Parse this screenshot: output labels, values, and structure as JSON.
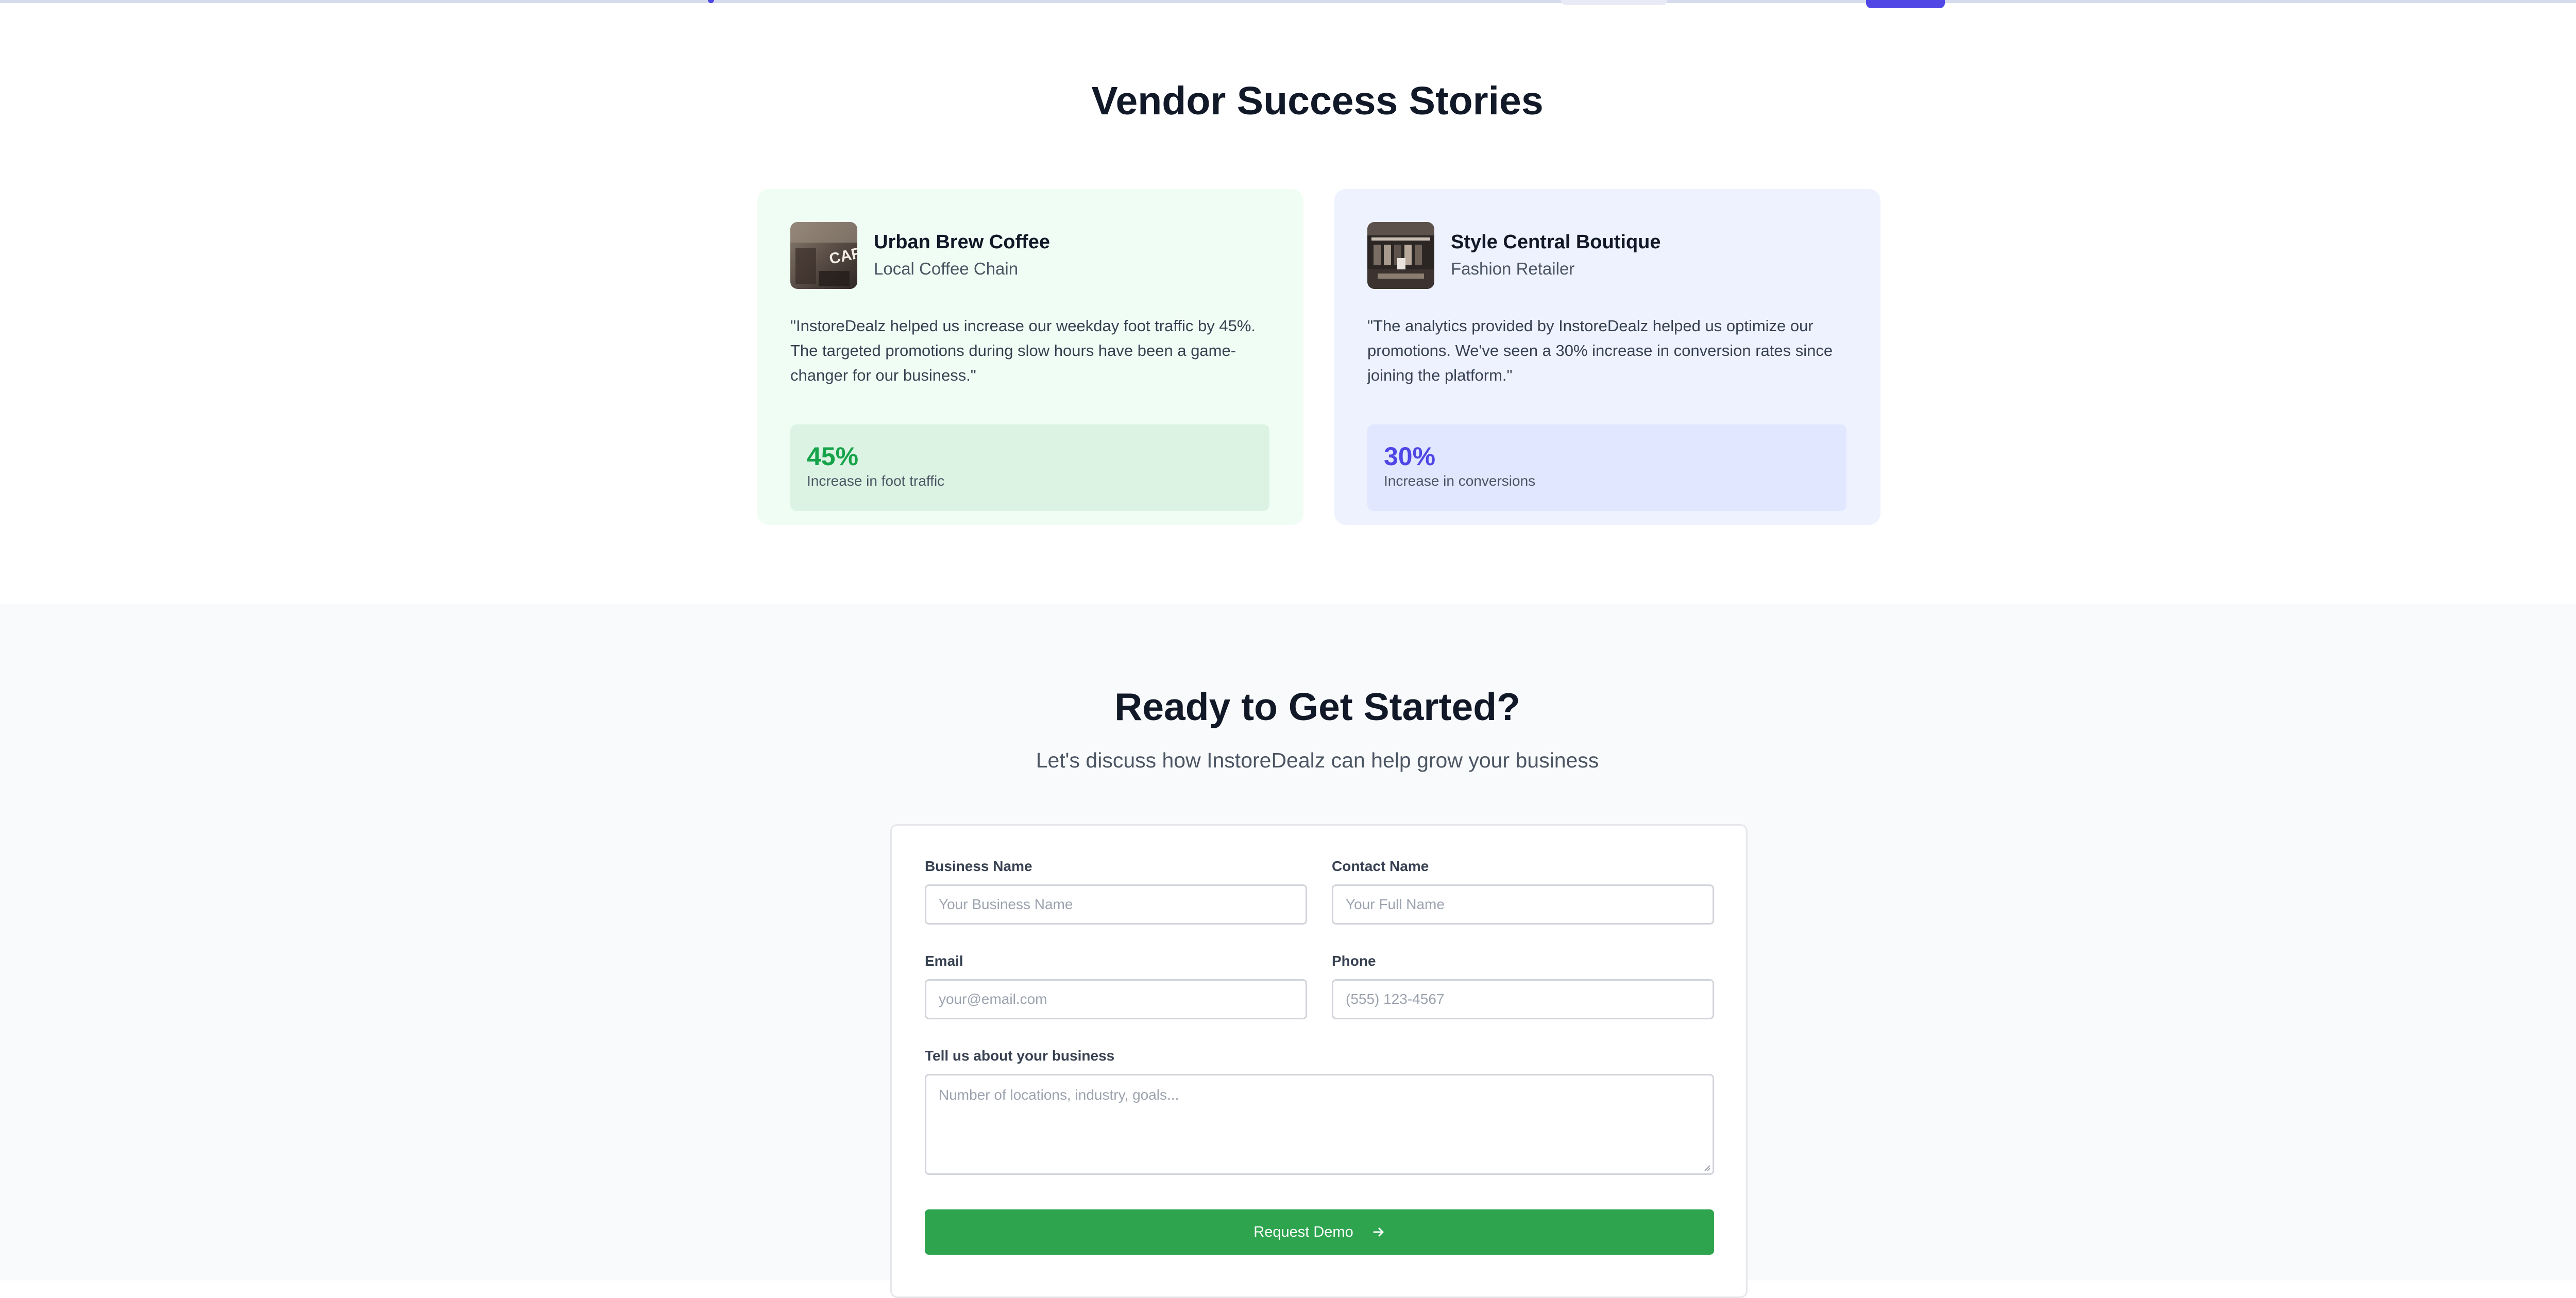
{
  "stories": {
    "title": "Vendor Success Stories",
    "cards": [
      {
        "name": "Urban Brew Coffee",
        "type": "Local Coffee Chain",
        "quote": "\"InstoreDealz helped us increase our weekday foot traffic by 45%. The targeted promotions during slow hours have been a game-changer for our business.\"",
        "stat_value": "45%",
        "stat_label": "Increase in foot traffic",
        "accent": "#16a34a"
      },
      {
        "name": "Style Central Boutique",
        "type": "Fashion Retailer",
        "quote": "\"The analytics provided by InstoreDealz helped us optimize our promotions. We've seen a 30% increase in conversion rates since joining the platform.\"",
        "stat_value": "30%",
        "stat_label": "Increase in conversions",
        "accent": "#4f46e5"
      }
    ]
  },
  "cta": {
    "title": "Ready to Get Started?",
    "subtitle": "Let's discuss how InstoreDealz can help grow your business",
    "form": {
      "business_name": {
        "label": "Business Name",
        "placeholder": "Your Business Name"
      },
      "contact_name": {
        "label": "Contact Name",
        "placeholder": "Your Full Name"
      },
      "email": {
        "label": "Email",
        "placeholder": "your@email.com"
      },
      "phone": {
        "label": "Phone",
        "placeholder": "(555) 123-4567"
      },
      "about": {
        "label": "Tell us about your business",
        "placeholder": "Number of locations, industry, goals..."
      },
      "submit_label": "Request Demo"
    },
    "submit_color": "#2ea44f"
  }
}
